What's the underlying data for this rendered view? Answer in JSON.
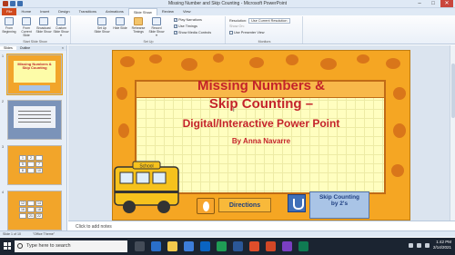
{
  "window": {
    "title": "Missing Number and Skip Counting  -  Microsoft PowerPoint",
    "controls": [
      "–",
      "□",
      "✕"
    ]
  },
  "ribbon_tabs": [
    "File",
    "Home",
    "Insert",
    "Design",
    "Transitions",
    "Animations",
    "Slide Show",
    "Review",
    "View"
  ],
  "active_tab": "Slide Show",
  "ribbon": {
    "start": {
      "group_label": "Start Slide Show",
      "buttons": [
        "From Beginning",
        "From Current Slide",
        "Broadcast Slide Show",
        "Custom Slide Show ▾"
      ]
    },
    "setup": {
      "group_label": "Set Up",
      "buttons": [
        "Set Up Slide Show",
        "Hide Slide",
        "Rehearse Timings",
        "Record Slide Show ▾"
      ],
      "checkboxes": [
        {
          "label": "Play Narrations",
          "checked": true
        },
        {
          "label": "Use Timings",
          "checked": true
        },
        {
          "label": "Show Media Controls",
          "checked": true
        }
      ]
    },
    "monitors": {
      "group_label": "Monitors",
      "resolution_label": "Resolution:",
      "resolution_value": "Use Current Resolution",
      "show_on_label": "Show On:",
      "presenter_view_label": "Use Presenter View"
    }
  },
  "left_panel": {
    "tabs": [
      "Slides",
      "Outline"
    ],
    "close": "×",
    "slide_numbers": [
      "1",
      "2",
      "3",
      "4"
    ],
    "thumb1_title": "Missing Numbers & Skip Counting",
    "thumb3_cells": [
      "1",
      "2",
      "",
      "5",
      "",
      "7",
      "8",
      "",
      "10"
    ],
    "thumb4_cells": [
      "12",
      "",
      "14",
      "16",
      "",
      "18",
      "",
      "21",
      "22"
    ]
  },
  "slide": {
    "title_line1": "Missing Numbers &",
    "title_line2": "Skip Counting –",
    "title_line3": "Digital/Interactive Power Point",
    "author": "By Anna Navarre",
    "bus_label": "School",
    "directions_button": "Directions",
    "skip_button_line1": "Skip Counting",
    "skip_button_line2": "by 2's"
  },
  "notes_placeholder": "Click to add notes",
  "status": {
    "slide_info": "Slide 1 of 10",
    "theme": "\"Office Theme\""
  },
  "taskbar": {
    "search_placeholder": "Type here to search",
    "time": "1:42 PM",
    "date": "2/14/2021"
  },
  "colors": {
    "slide_background": "#f5a623",
    "title_red": "#c4232a",
    "board_yellow": "#fffec0",
    "button_blue": "#a9c4e6",
    "file_tab": "#d04a1e"
  }
}
